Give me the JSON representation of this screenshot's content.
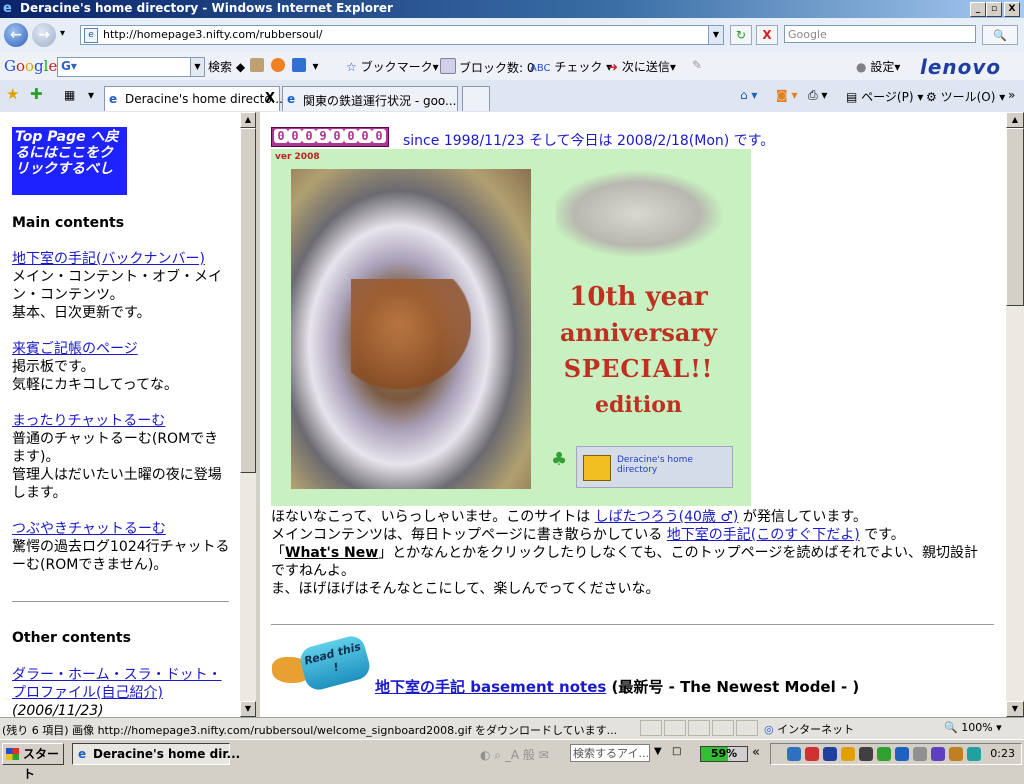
{
  "window": {
    "title": "Deracine's home directory - Windows Internet Explorer",
    "min": "_",
    "max": "▫",
    "close": "X"
  },
  "nav": {
    "back": "←",
    "forward": "→",
    "dropdown": "▾",
    "url": "http://homepage3.nifty.com/rubbersoul/",
    "refresh": "↻",
    "stop": "X",
    "search_placeholder": "Google",
    "search_go": "🔍"
  },
  "google_toolbar": {
    "logo": "Google",
    "selector": "G▾",
    "search_label": "検索",
    "bookmark_label": "ブックマーク▾",
    "popup_label": "ブロック数: 0",
    "check_label": "チェック",
    "send_label": "次に送信▾",
    "settings_label": "設定▾",
    "lenovo": "lenovo"
  },
  "tabs": [
    {
      "label": "Deracine's home directo...",
      "active": true,
      "close": "X"
    },
    {
      "label": "関東の鉄道運行状況 - goo...",
      "active": false
    }
  ],
  "command_bar": {
    "page_label": "ページ(P) ▾",
    "tools_label": "ツール(O) ▾",
    "more": "»"
  },
  "left": {
    "top_link": "Top Page へ戻るにはここをクリックするべし",
    "main_heading": "Main contents",
    "items": [
      {
        "link": "地下室の手記(バックナンバー)",
        "desc": "メイン・コンテント・オブ・メイン・コンテンツ。\n基本、日次更新です。"
      },
      {
        "link": "来賓ご記帳のページ",
        "desc": "掲示板です。\n気軽にカキコしてってな。"
      },
      {
        "link": "まったりチャットるーむ",
        "desc": "普通のチャットるーむ(ROMできます)。\n管理人はだいたい土曜の夜に登場します。"
      },
      {
        "link": "つぶやきチャットるーむ",
        "desc": "驚愕の過去ログ1024行チャットるーむ(ROMできません)。"
      }
    ],
    "other_heading": "Other contents",
    "profile_link": "ダラー・ホーム・スラ・ドット・プロファイル(自己紹介)",
    "profile_date": "(2006/11/23)"
  },
  "right": {
    "counter_digits": [
      "0",
      "0",
      "0",
      "9",
      "0",
      "0",
      "0",
      "0"
    ],
    "since_text": "since 1998/11/23 そして今日は 2008/2/18(Mon) です。",
    "banner": {
      "version": "ver 2008",
      "line1": "10th year",
      "line2": "anniversary",
      "line3": "SPECIAL!!",
      "line4": "edition",
      "sponsor": "Deracine's home directory"
    },
    "intro1_pre": "ほないなこって、いらっしゃいませ。このサイトは ",
    "intro1_link": "しばたつろう(40歳 ♂)",
    "intro1_post": " が発信しています。",
    "intro2_pre": "メインコンテンツは、毎日トップページに書き散らかしている ",
    "intro2_link": "地下室の手記(このすぐ下だよ)",
    "intro2_post": " です。",
    "intro3_pre": "「",
    "intro3_link": "What's New",
    "intro3_post": "」とかなんとかをクリックしたりしなくても、このトップページを読めばそれでよい、親切設計ですねんよ。",
    "intro4": "ま、ほげほげはそんなとこにして、楽しんでってくださいな。",
    "read_this": "Read this !",
    "notes_link": "地下室の手記 basement notes",
    "notes_suffix": " (最新号 - The Newest Model - )"
  },
  "status": {
    "message": "(残り 6 項目) 画像 http://homepage3.nifty.com/rubbersoul/welcome_signboard2008.gif をダウンロードしています...",
    "zone": "インターネット",
    "zoom": "100% ▾"
  },
  "taskbar": {
    "start": "スタート",
    "task": "Deracine's home dir...",
    "search": "検索するアイ...",
    "battery_text": "59%",
    "battery_level": 0.59,
    "clock": "0:23"
  }
}
